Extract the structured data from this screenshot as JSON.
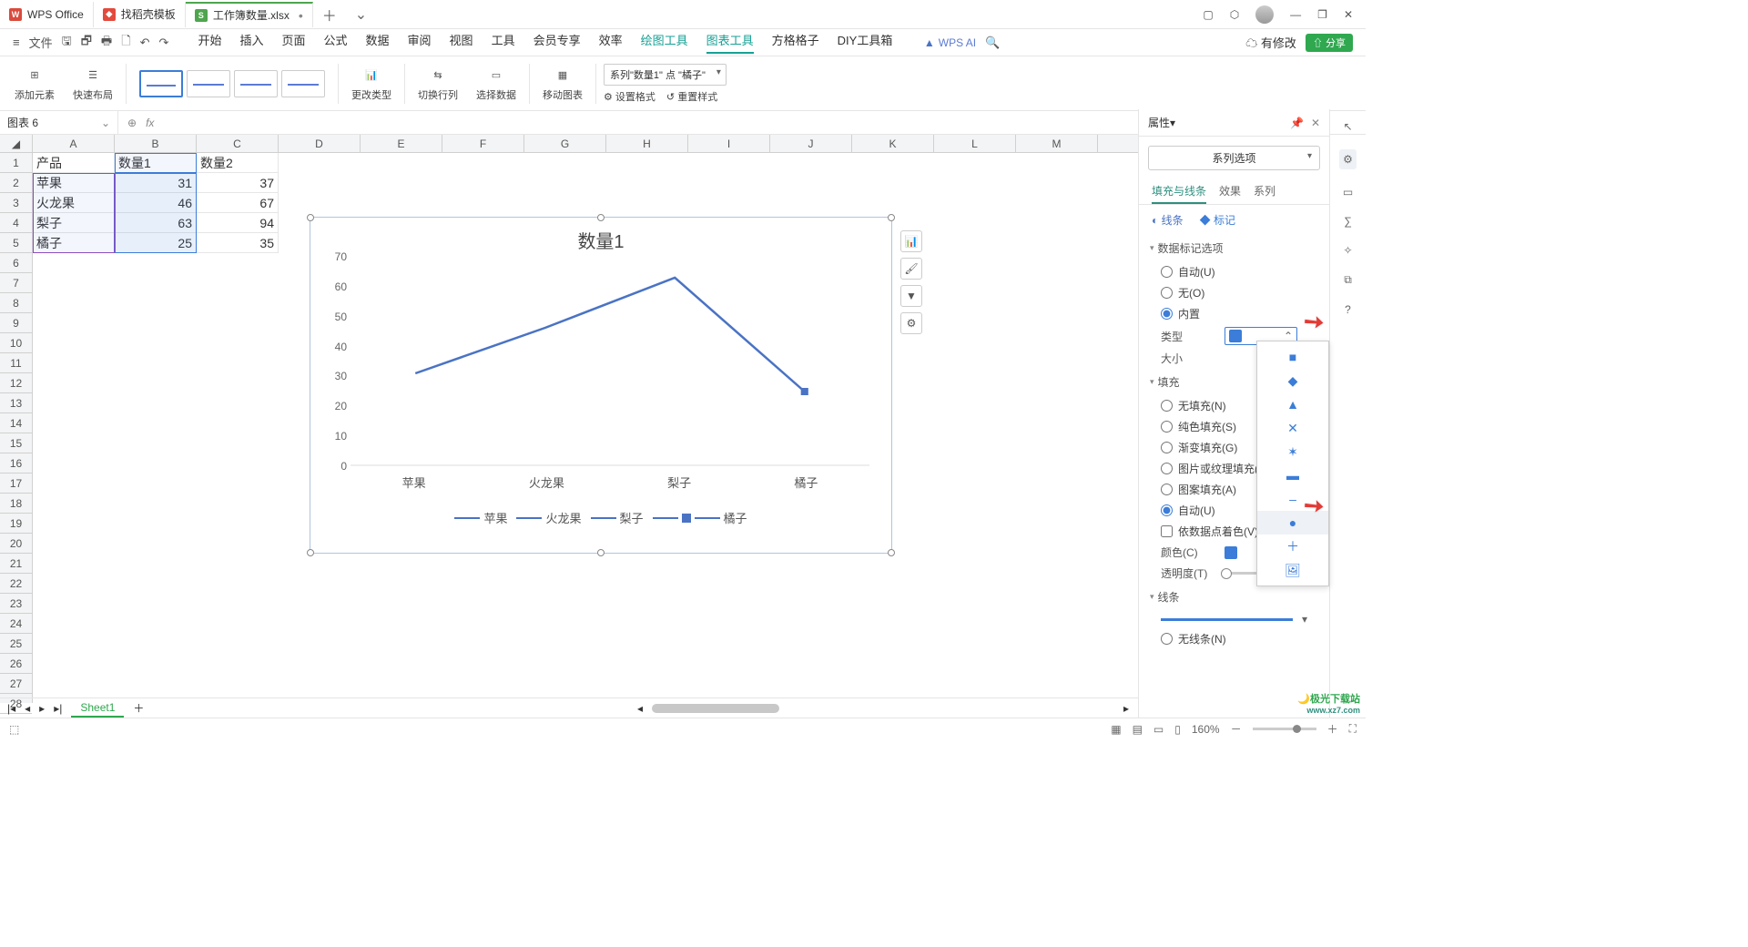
{
  "tabs": {
    "t1": "WPS Office",
    "t2": "找稻壳模板",
    "t3": "工作簿数量.xlsx"
  },
  "menu": {
    "file": "文件",
    "items": [
      "开始",
      "插入",
      "页面",
      "公式",
      "数据",
      "审阅",
      "视图",
      "工具",
      "会员专享",
      "效率",
      "绘图工具",
      "图表工具",
      "方格格子",
      "DIY工具箱"
    ],
    "ai": "WPS AI",
    "mod": "有修改",
    "share": "分享"
  },
  "ribbon": {
    "addel": "添加元素",
    "quick": "快速布局",
    "changetype": "更改类型",
    "switch": "切换行列",
    "seldata": "选择数据",
    "movechart": "移动图表",
    "seriesdd": "系列\"数量1\" 点 \"橘子\"",
    "setfmt": "设置格式",
    "resetstyle": "重置样式"
  },
  "namebox": "图表 6",
  "fx": "fx",
  "cols": [
    "A",
    "B",
    "C",
    "D",
    "E",
    "F",
    "G",
    "H",
    "I",
    "J",
    "K",
    "L",
    "M"
  ],
  "table": {
    "h1": "产品",
    "h2": "数量1",
    "h3": "数量2",
    "rows": [
      {
        "a": "苹果",
        "b": "31",
        "c": "37"
      },
      {
        "a": "火龙果",
        "b": "46",
        "c": "67"
      },
      {
        "a": "梨子",
        "b": "63",
        "c": "94"
      },
      {
        "a": "橘子",
        "b": "25",
        "c": "35"
      }
    ]
  },
  "chart_data": {
    "type": "line",
    "title": "数量1",
    "categories": [
      "苹果",
      "火龙果",
      "梨子",
      "橘子"
    ],
    "values": [
      31,
      46,
      63,
      25
    ],
    "legend": [
      "苹果",
      "火龙果",
      "梨子",
      "橘子"
    ],
    "ylim": [
      0,
      70
    ],
    "yticks": [
      0,
      10,
      20,
      30,
      40,
      50,
      60,
      70
    ]
  },
  "panel": {
    "title": "属性",
    "seriesdd": "系列选项",
    "tabs": {
      "fill": "填充与线条",
      "effect": "效果",
      "series": "系列"
    },
    "links": {
      "line": "线条",
      "mark": "标记"
    },
    "sec_marker": "数据标记选项",
    "opt_auto": "自动(U)",
    "opt_none": "无(O)",
    "opt_builtin": "内置",
    "k_type": "类型",
    "k_size": "大小",
    "sec_fill": "填充",
    "f_none": "无填充(N)",
    "f_solid": "纯色填充(S)",
    "f_grad": "渐变填充(G)",
    "f_pic": "图片或纹理填充(P)",
    "f_patt": "图案填充(A)",
    "f_auto": "自动(U)",
    "f_bypoint": "依数据点着色(V)",
    "k_color": "颜色(C)",
    "k_trans": "透明度(T)",
    "sec_line": "线条",
    "l_none": "无线条(N)"
  },
  "sheet": "Sheet1",
  "zoom": "160%"
}
